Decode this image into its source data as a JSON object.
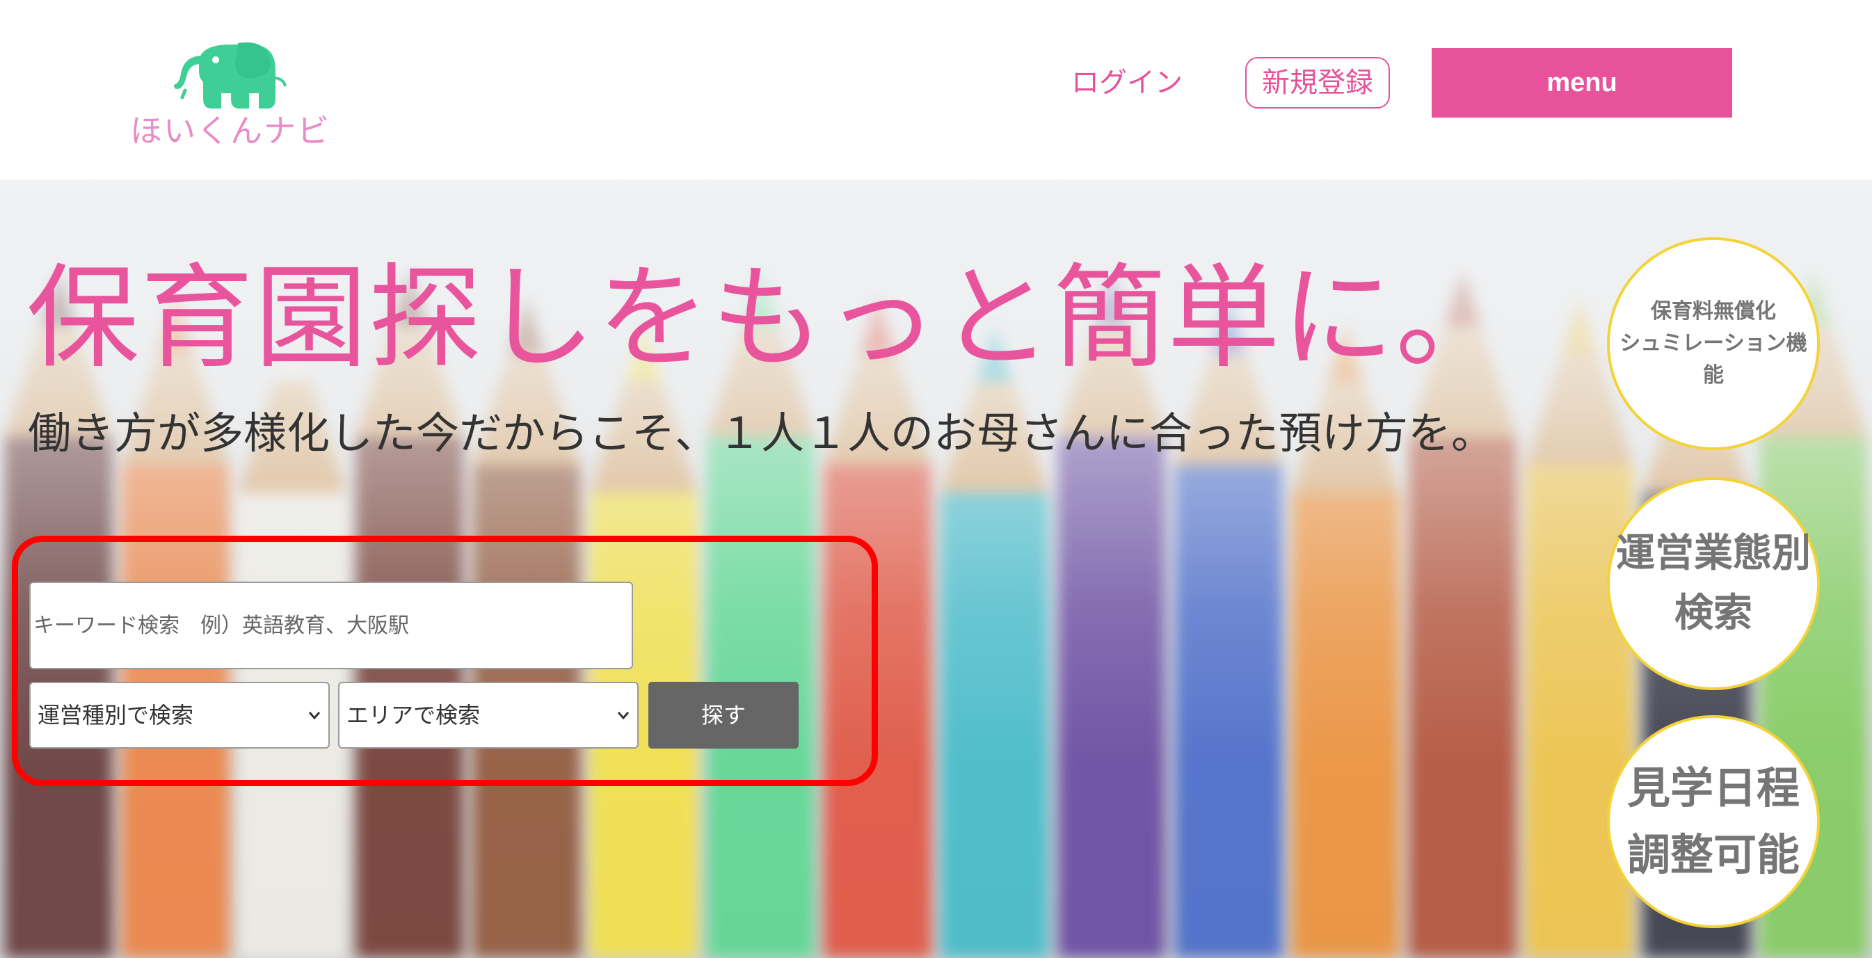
{
  "header": {
    "logo_text": "ほいくんナビ",
    "logo_icon": "elephant-icon",
    "login_label": "ログイン",
    "register_label": "新規登録",
    "menu_label": "menu"
  },
  "hero": {
    "headline": "保育園探しをもっと簡単に。",
    "subline": "働き方が多様化した今だからこそ、１人１人のお母さんに合った預け方を。"
  },
  "search": {
    "keyword_placeholder": "キーワード検索　例）英語教育、大阪駅",
    "type_select": {
      "selected": "運営種別で検索"
    },
    "area_select": {
      "selected": "エリアで検索"
    },
    "submit_label": "探す"
  },
  "features": [
    {
      "label": "保育料無償化\nシュミレーション機能"
    },
    {
      "label": "運営業態別\n検索"
    },
    {
      "label": "見学日程\n調整可能"
    }
  ],
  "colors": {
    "accent_pink": "#e8529b",
    "logo_green": "#3fcf96",
    "highlight_red": "#ff0000",
    "feature_border_yellow": "#f4d338",
    "button_gray": "#666666"
  }
}
